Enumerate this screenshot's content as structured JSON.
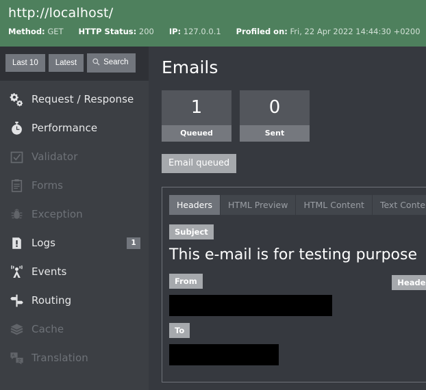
{
  "header": {
    "url": "http://localhost/",
    "meta": [
      {
        "key": "Method:",
        "value": "GET"
      },
      {
        "key": "HTTP Status:",
        "value": "200"
      },
      {
        "key": "IP:",
        "value": "127.0.0.1"
      },
      {
        "key": "Profiled on:",
        "value": "Fri, 22 Apr 2022 14:44:30 +0200"
      }
    ]
  },
  "sidebar": {
    "toolbar": {
      "last10": "Last 10",
      "latest": "Latest",
      "search": "Search",
      "search_icon": "magnifier-icon"
    },
    "items": [
      {
        "label": "Request / Response",
        "icon": "gears-icon",
        "disabled": false,
        "count": ""
      },
      {
        "label": "Performance",
        "icon": "stopwatch-icon",
        "disabled": false,
        "count": ""
      },
      {
        "label": "Validator",
        "icon": "checkbox-icon",
        "disabled": true,
        "count": ""
      },
      {
        "label": "Forms",
        "icon": "clipboard-icon",
        "disabled": true,
        "count": ""
      },
      {
        "label": "Exception",
        "icon": "bug-icon",
        "disabled": true,
        "count": ""
      },
      {
        "label": "Logs",
        "icon": "log-file-icon",
        "disabled": false,
        "count": "1"
      },
      {
        "label": "Events",
        "icon": "broadcast-icon",
        "disabled": false,
        "count": ""
      },
      {
        "label": "Routing",
        "icon": "signpost-icon",
        "disabled": false,
        "count": ""
      },
      {
        "label": "Cache",
        "icon": "layers-icon",
        "disabled": true,
        "count": ""
      },
      {
        "label": "Translation",
        "icon": "translation-icon",
        "disabled": true,
        "count": ""
      }
    ]
  },
  "main": {
    "title": "Emails",
    "cards": [
      {
        "value": "1",
        "caption": "Queued"
      },
      {
        "value": "0",
        "caption": "Sent"
      }
    ],
    "status_button": "Email queued",
    "tabs": [
      {
        "label": "Headers",
        "active": true
      },
      {
        "label": "HTML Preview",
        "active": false
      },
      {
        "label": "HTML Content",
        "active": false
      },
      {
        "label": "Text Content",
        "active": false
      }
    ],
    "fields": {
      "subject_tag": "Subject",
      "subject_value": "This e-mail is for testing purpose",
      "from_tag": "From",
      "from_value": "",
      "to_tag": "To",
      "to_value": "",
      "headers_tag": "Headers"
    }
  },
  "colors": {
    "header_green": "#4e805d",
    "sidebar_bg": "#3c3f44",
    "main_bg": "#36393f",
    "accent_grey": "#a6a9ad",
    "redaction": "#000000"
  }
}
